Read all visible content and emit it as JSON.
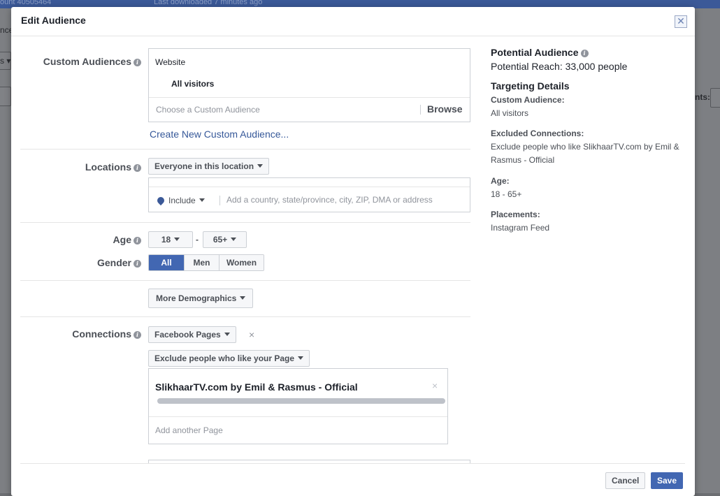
{
  "background": {
    "topbar_left": "ount 40505464",
    "topbar_right": "Last downloaded 7 minutes ago",
    "frag_left1": "nce",
    "frag_left2": "s ▾",
    "frag_right": "nts:"
  },
  "dialog": {
    "title": "Edit Audience",
    "close_symbol": "✕"
  },
  "custom_audiences": {
    "label": "Custom Audiences",
    "category": "Website",
    "selected": "All visitors",
    "placeholder": "Choose a Custom Audience",
    "browse": "Browse",
    "create_link": "Create New Custom Audience..."
  },
  "locations": {
    "label": "Locations",
    "scope": "Everyone in this location",
    "include": "Include",
    "placeholder": "Add a country, state/province, city, ZIP, DMA or address"
  },
  "age": {
    "label": "Age",
    "min": "18",
    "dash": "-",
    "max": "65+"
  },
  "gender": {
    "label": "Gender",
    "options": [
      "All",
      "Men",
      "Women"
    ],
    "selected": "All"
  },
  "more_demographics": "More Demographics",
  "connections": {
    "label": "Connections",
    "type": "Facebook Pages",
    "remove_symbol": "×",
    "exclude": "Exclude people who like your Page",
    "page_name": "SlikhaarTV.com by Emil & Rasmus - Official",
    "add_placeholder": "Add another Page"
  },
  "footer": {
    "cancel": "Cancel",
    "save": "Save"
  },
  "summary": {
    "potential_title": "Potential Audience",
    "potential_reach": "Potential Reach: 33,000 people",
    "targeting_title": "Targeting Details",
    "custom_audience_label": "Custom Audience:",
    "custom_audience_value": "All visitors",
    "excluded_label": "Excluded Connections:",
    "excluded_value": "Exclude people who like SlikhaarTV.com by Emil & Rasmus - Official",
    "age_label": "Age:",
    "age_value": "18 - 65+",
    "placements_label": "Placements:",
    "placements_value": "Instagram Feed"
  },
  "colors": {
    "accent": "#4267b2",
    "link": "#365899",
    "topbar": "#3b5998"
  }
}
